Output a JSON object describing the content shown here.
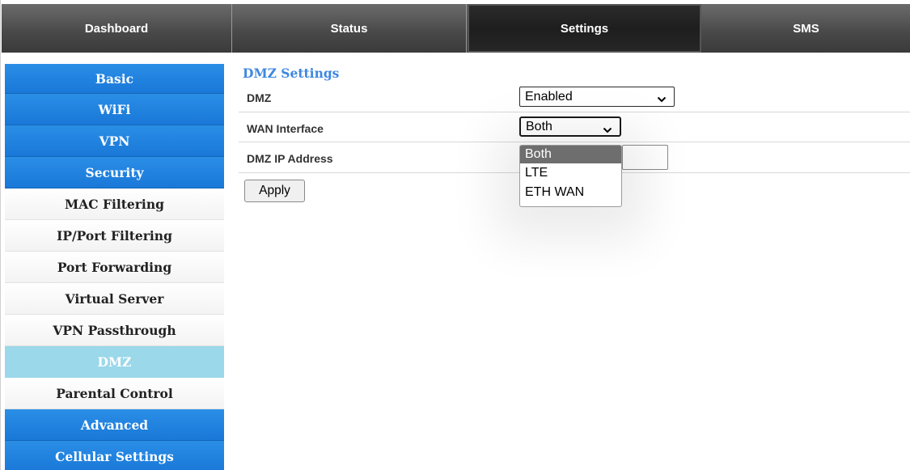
{
  "nav": {
    "tabs": [
      {
        "label": "Dashboard"
      },
      {
        "label": "Status"
      },
      {
        "label": "Settings"
      },
      {
        "label": "SMS"
      }
    ],
    "active_tab": "Settings"
  },
  "sidebar": {
    "items": [
      {
        "label": "Basic"
      },
      {
        "label": "WiFi"
      },
      {
        "label": "VPN"
      },
      {
        "label": "Security"
      },
      {
        "label": "MAC Filtering"
      },
      {
        "label": "IP/Port Filtering"
      },
      {
        "label": "Port Forwarding"
      },
      {
        "label": "Virtual Server"
      },
      {
        "label": "VPN Passthrough"
      },
      {
        "label": "DMZ"
      },
      {
        "label": "Parental Control"
      },
      {
        "label": "Advanced"
      },
      {
        "label": "Cellular Settings"
      }
    ],
    "active_item": "DMZ"
  },
  "main": {
    "title": "DMZ Settings",
    "dmz": {
      "label": "DMZ",
      "value": "Enabled"
    },
    "wan_interface": {
      "label": "WAN Interface",
      "value": "Both"
    },
    "dmz_ip": {
      "label": "DMZ IP Address",
      "value": ""
    },
    "apply_label": "Apply"
  },
  "dropdown": {
    "options": [
      {
        "label": "Both"
      },
      {
        "label": "LTE"
      },
      {
        "label": "ETH WAN"
      }
    ],
    "selected": "Both"
  },
  "colors": {
    "sidebar_blue": "#1f82dc",
    "sidebar_active": "#9ad8ea",
    "title_blue": "#3f87e0",
    "nav_dark": "#4a4a4a"
  }
}
